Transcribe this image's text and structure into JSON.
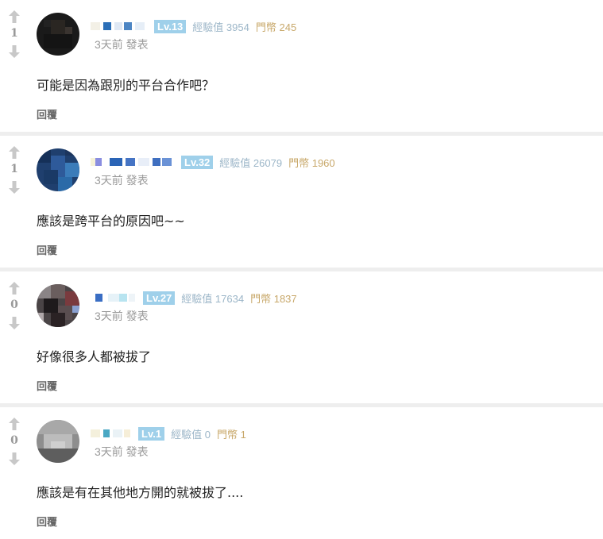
{
  "colors": {
    "level_badge_bg": "#9fd0ea",
    "exp_text": "#9cb6c8",
    "coin_text": "#c8a86a",
    "separator": "#eeeeee"
  },
  "comments": [
    {
      "votes": "1",
      "level": "Lv.13",
      "exp_label": "經驗值",
      "exp_value": "3954",
      "coin_label": "門幣",
      "coin_value": "245",
      "time": "3天前 發表",
      "text": "可能是因為跟別的平台合作吧？",
      "reply_label": "回覆"
    },
    {
      "votes": "1",
      "level": "Lv.32",
      "exp_label": "經驗值",
      "exp_value": "26079",
      "coin_label": "門幣",
      "coin_value": "1960",
      "time": "3天前 發表",
      "text": "應該是跨平台的原因吧~~",
      "reply_label": "回覆"
    },
    {
      "votes": "0",
      "level": "Lv.27",
      "exp_label": "經驗值",
      "exp_value": "17634",
      "coin_label": "門幣",
      "coin_value": "1837",
      "time": "3天前 發表",
      "text": "好像很多人都被拔了",
      "reply_label": "回覆"
    },
    {
      "votes": "0",
      "level": "Lv.1",
      "exp_label": "經驗值",
      "exp_value": "0",
      "coin_label": "門幣",
      "coin_value": "1",
      "time": "3天前 發表",
      "text": "應該是有在其他地方開的就被拔了....",
      "reply_label": "回覆"
    }
  ]
}
